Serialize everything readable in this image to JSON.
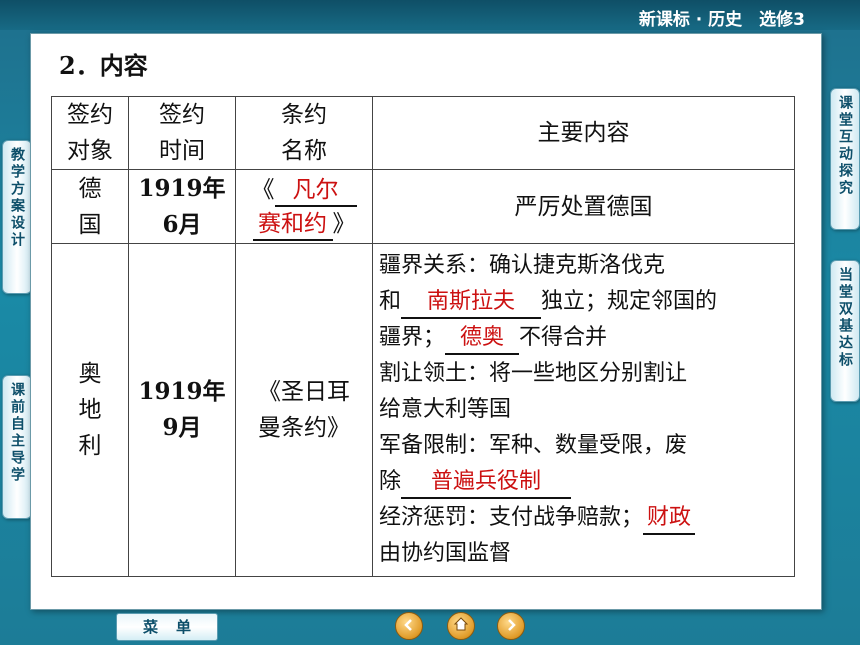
{
  "header": {
    "title": "新课标 · 历史　选修3"
  },
  "section": {
    "title": "2．内容"
  },
  "table": {
    "headers": {
      "party": [
        "签约",
        "对象"
      ],
      "date": [
        "签约",
        "时间"
      ],
      "name": [
        "条约",
        "名称"
      ],
      "content": "主要内容"
    },
    "rows": [
      {
        "party": [
          "德",
          "国"
        ],
        "date": [
          "1919年",
          "6月"
        ],
        "name_open": "《",
        "name_blank_1": "凡尔",
        "name_blank_2": "赛和约",
        "name_close": "》",
        "content": "严厉处置德国"
      },
      {
        "party": [
          "奥",
          "地",
          "利"
        ],
        "date": [
          "1919年",
          "9月"
        ],
        "name": [
          "《圣日耳",
          "曼条约》"
        ],
        "content": {
          "line1": "疆界关系：确认捷克斯洛伐克",
          "line2_pre": "和",
          "blank_1": "南斯拉夫",
          "line2_post": "独立；规定邻国的",
          "line3_pre": "疆界；",
          "blank_2": "德奥",
          "line3_post": "不得合并",
          "line4": "割让领土：将一些地区分别割让",
          "line5": "给意大利等国",
          "line6": "军备限制：军种、数量受限，废",
          "line7_pre": "除",
          "blank_3": "普遍兵役制",
          "line8_pre": "经济惩罚：支付战争赔款；",
          "blank_4": "财政",
          "line9": "由协约国监督"
        }
      }
    ]
  },
  "side_tabs": {
    "left_1": "教学方案设计",
    "left_2": "课前自主导学",
    "right_1": "课堂互动探究",
    "right_2": "当堂双基达标"
  },
  "bottom": {
    "menu_label": "菜单"
  },
  "icons": {
    "home": "home-icon",
    "back": "back-icon",
    "forward": "forward-icon"
  }
}
